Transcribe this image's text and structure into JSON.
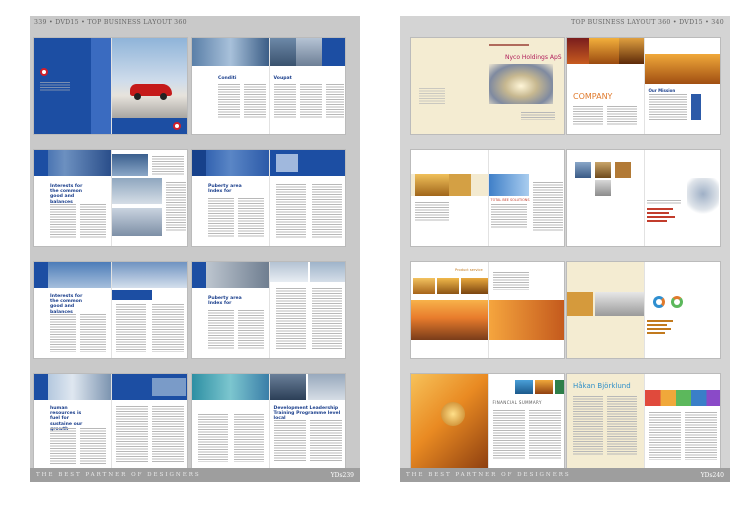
{
  "left_page": {
    "header": "339 • DVD15 • TOP BUSINESS LAYOUT 360",
    "footer_slogan": "THE BEST PARTNER OF DESIGNERS",
    "footer_tag": "YDs239"
  },
  "right_page": {
    "header": "TOP BUSINESS LAYOUT 360 • DVD15 • 340",
    "footer_slogan": "THE BEST PARTNER OF DESIGNERS",
    "footer_tag": "YDs240"
  },
  "spreads": {
    "l1": {},
    "l2": {
      "col_a": "Conditi",
      "col_b": "Voupat"
    },
    "l3": {
      "headline": "Interests for the common good and balances"
    },
    "l4": {
      "headline": "Puberty area Index for"
    },
    "l5": {
      "headline": "Interests for the common good and balances"
    },
    "l6": {
      "headline": "Puberty area Index for"
    },
    "l7": {
      "headline": "human resources is fuel for sustaine our growth"
    },
    "l8": {
      "headline": "Development Leadership Training Programme level local"
    },
    "r1": {
      "company": "Nyco Holdings ApS"
    },
    "r2": {
      "title": "COMPANY",
      "overlay": "Our Mission"
    },
    "r3": {
      "heading": "TOTAL BEE SOLUTIONS"
    },
    "r4": {},
    "r5": {
      "label": "Product service"
    },
    "r6": {},
    "r7": {
      "heading": "FINANCIAL SUMMARY"
    },
    "r8": {
      "name": "Håkan Björklund"
    }
  }
}
